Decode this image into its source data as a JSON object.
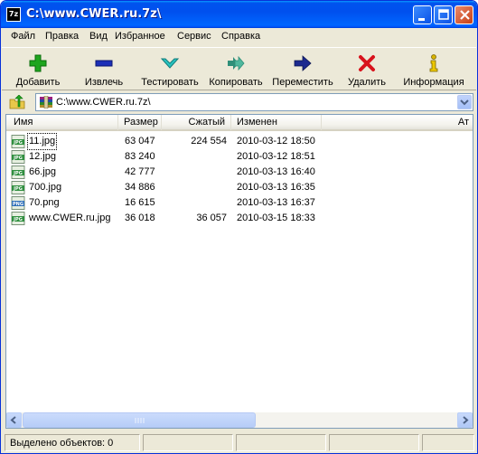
{
  "window": {
    "title": "C:\\www.CWER.ru.7z\\",
    "app_icon_text": "7z"
  },
  "menu": [
    "Файл",
    "Правка",
    "Вид",
    "Избранное",
    "Сервис",
    "Справка"
  ],
  "toolbar": [
    {
      "label": "Добавить",
      "icon": "plus-icon",
      "color": "#1ea51e"
    },
    {
      "label": "Извлечь",
      "icon": "minus-icon",
      "color": "#1c2fb8"
    },
    {
      "label": "Тестировать",
      "icon": "check-icon",
      "color": "#27c3c0"
    },
    {
      "label": "Копировать",
      "icon": "double-arrow-icon",
      "color": "#2f8f79"
    },
    {
      "label": "Переместить",
      "icon": "arrow-right-icon",
      "color": "#1c2a8f"
    },
    {
      "label": "Удалить",
      "icon": "x-icon",
      "color": "#d8121c"
    },
    {
      "label": "Информация",
      "icon": "info-icon",
      "color": "#d8b300"
    }
  ],
  "address": {
    "path": "C:\\www.CWER.ru.7z\\"
  },
  "columns": [
    "Имя",
    "Размер",
    "Сжатый",
    "Изменен",
    "Ат"
  ],
  "files": [
    {
      "name": "11.jpg",
      "type": "JPG",
      "size": "63 047",
      "packed": "224 554",
      "modified": "2010-03-12 18:50"
    },
    {
      "name": "12.jpg",
      "type": "JPG",
      "size": "83 240",
      "packed": "",
      "modified": "2010-03-12 18:51"
    },
    {
      "name": "66.jpg",
      "type": "JPG",
      "size": "42 777",
      "packed": "",
      "modified": "2010-03-13 16:40"
    },
    {
      "name": "700.jpg",
      "type": "JPG",
      "size": "34 886",
      "packed": "",
      "modified": "2010-03-13 16:35"
    },
    {
      "name": "70.png",
      "type": "PNG",
      "size": "16 615",
      "packed": "",
      "modified": "2010-03-13 16:37"
    },
    {
      "name": "www.CWER.ru.jpg",
      "type": "JPG",
      "size": "36 018",
      "packed": "36 057",
      "modified": "2010-03-15 18:33"
    }
  ],
  "status": {
    "selected": "Выделено объектов: 0"
  }
}
